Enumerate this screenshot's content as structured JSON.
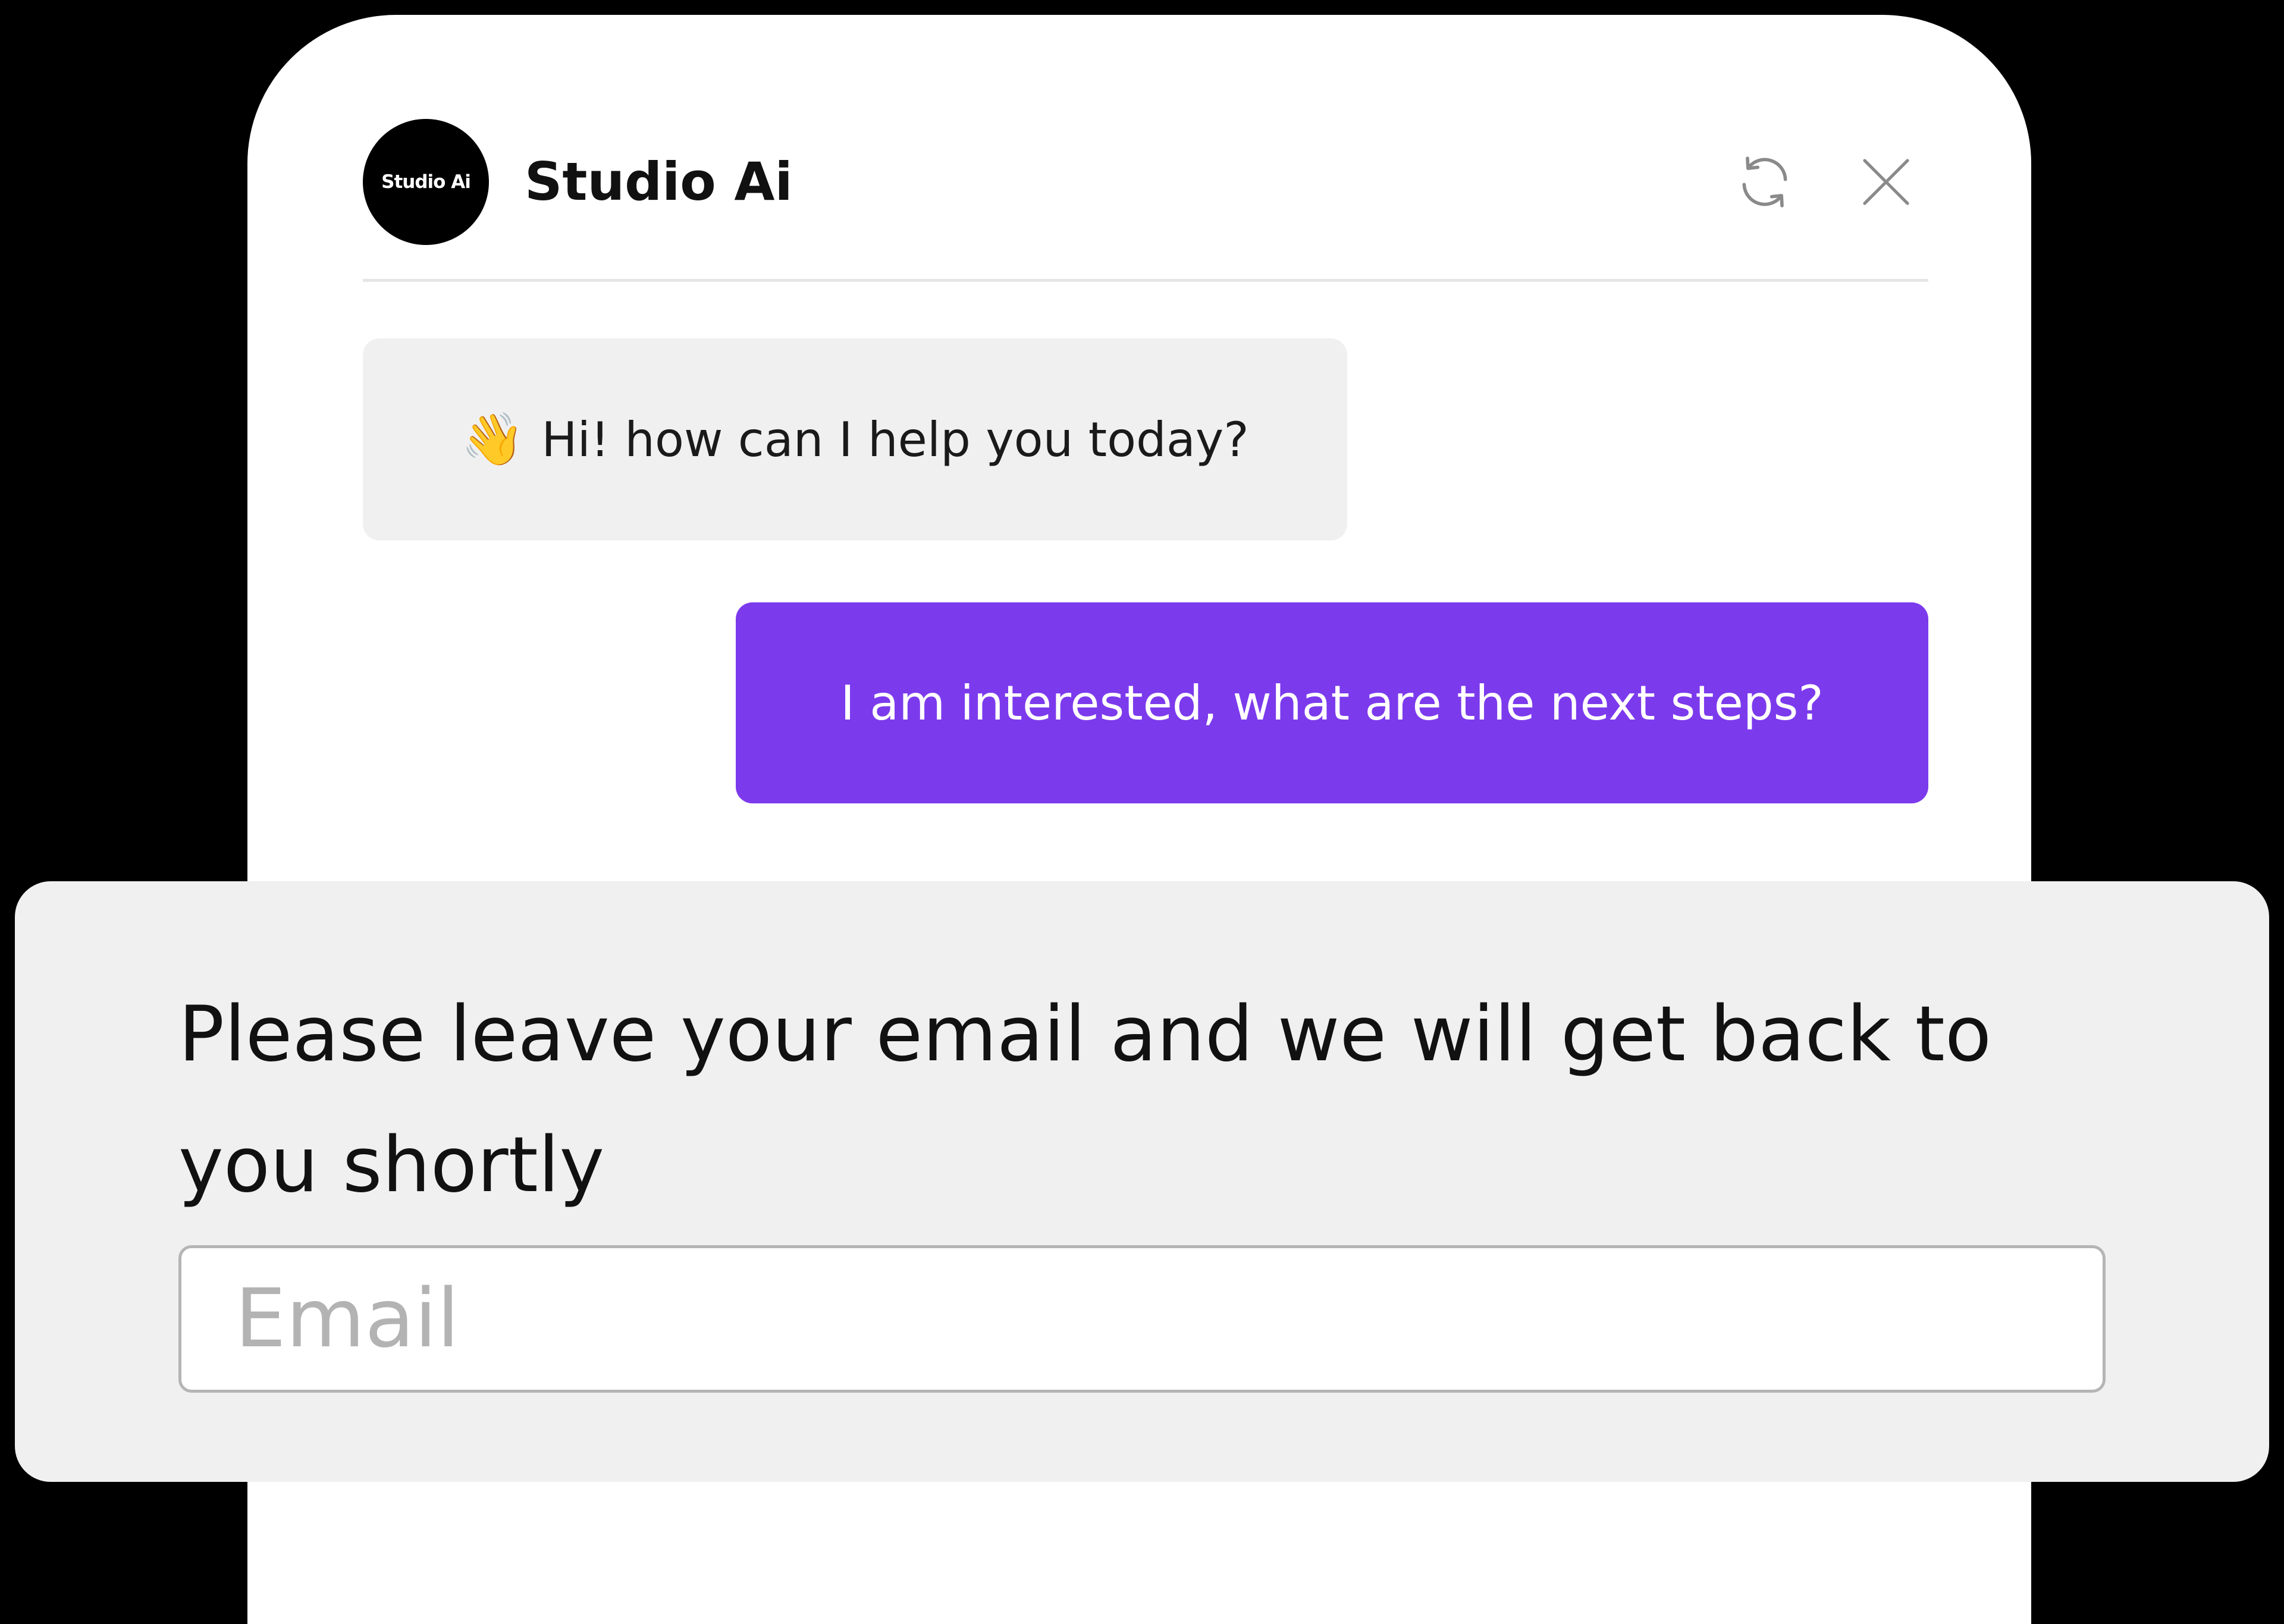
{
  "header": {
    "avatar_text": "Studio Ai",
    "bot_name": "Studio Ai",
    "refresh_icon": "refresh-icon",
    "close_icon": "close-icon"
  },
  "messages": [
    {
      "role": "bot",
      "icon": "waving-hand-icon",
      "emoji": "👋",
      "text": "Hi! how can I help you today?"
    },
    {
      "role": "user",
      "text": "I am interested, what are the next steps?"
    }
  ],
  "email_prompt": {
    "text": "Please leave your email and we will get back to you shortly",
    "input_value": "",
    "input_placeholder": "Email"
  },
  "colors": {
    "accent": "#7c3aed",
    "bot_bubble": "#f0f0f0",
    "panel": "#f0f0f0",
    "background": "#000000"
  }
}
